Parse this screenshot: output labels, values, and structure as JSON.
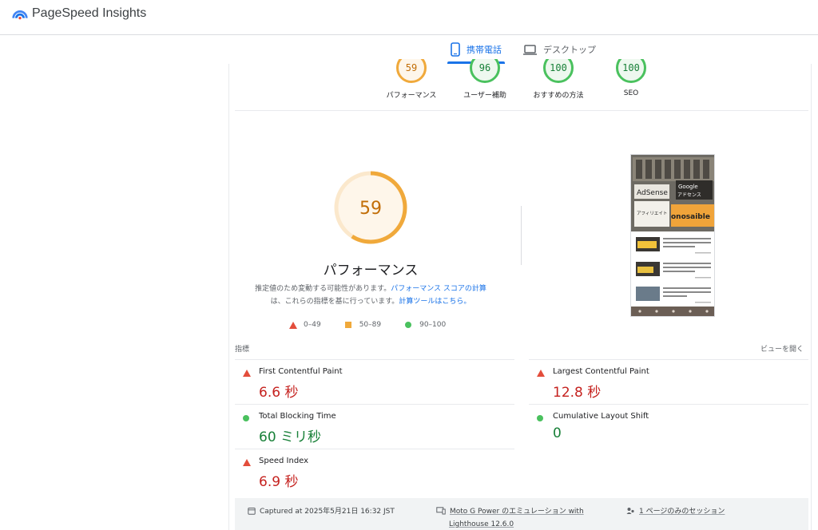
{
  "app": {
    "title": "PageSpeed Insights"
  },
  "tabs": [
    {
      "label": "携帯電話",
      "icon": "phone-icon",
      "active": true
    },
    {
      "label": "デスクトップ",
      "icon": "laptop-icon",
      "active": false
    }
  ],
  "summary": [
    {
      "score": "59",
      "label": "パフォーマンス",
      "color": "#f0a93b"
    },
    {
      "score": "96",
      "label": "ユーザー補助",
      "color": "#4ac15e"
    },
    {
      "score": "100",
      "label": "おすすめの方法",
      "color": "#4ac15e"
    },
    {
      "score": "100",
      "label": "SEO",
      "color": "#4ac15e"
    }
  ],
  "performance": {
    "score": "59",
    "score_fraction": 0.59,
    "title": "パフォーマンス",
    "desc_part1": "推定値のため変動する可能性があります。",
    "desc_link1": "パフォーマンス スコアの計算",
    "desc_part2": "は、これらの指標を基に行っています。",
    "desc_link2": "計算ツールはこちら。"
  },
  "legend": [
    {
      "shape": "triangle",
      "label": "0–49",
      "color": "#e34d3b"
    },
    {
      "shape": "square",
      "label": "50–89",
      "color": "#f0a93b"
    },
    {
      "shape": "circle",
      "label": "90–100",
      "color": "#4ac15e"
    }
  ],
  "metrics_section": {
    "heading": "指標",
    "expand_label": "ビューを開く"
  },
  "metrics": [
    {
      "name": "First Contentful Paint",
      "value": "6.6 秒",
      "status": "poor"
    },
    {
      "name": "Largest Contentful Paint",
      "value": "12.8 秒",
      "status": "poor"
    },
    {
      "name": "Total Blocking Time",
      "value": "60 ミリ秒",
      "status": "good"
    },
    {
      "name": "Cumulative Layout Shift",
      "value": "0",
      "status": "good"
    },
    {
      "name": "Speed Index",
      "value": "6.9 秒",
      "status": "poor"
    }
  ],
  "thumbnail": {
    "hero_words": [
      "AdSense",
      "Google",
      "アドセンス",
      "アフィリエイト",
      "onosaible"
    ]
  },
  "footer": {
    "captured": "Captured at 2025年5月21日 16:32 JST",
    "device": "Moto G Power のエミュレーション with",
    "lighthouse": "Lighthouse 12.6.0",
    "session": "1 ページのみのセッション"
  }
}
